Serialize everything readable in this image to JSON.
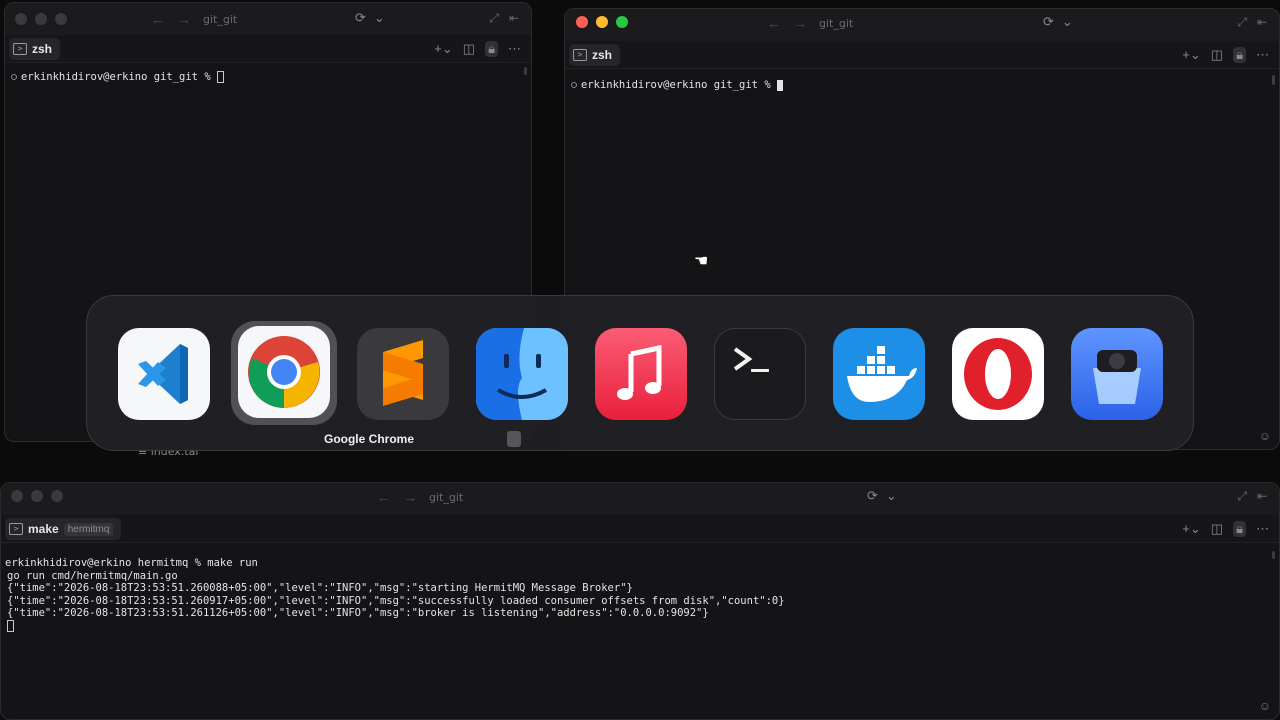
{
  "windows": {
    "top_left": {
      "title": "git_git",
      "tab_label": "zsh",
      "prompt": "erkinkhidirov@erkino git_git % "
    },
    "top_right": {
      "title": "git_git",
      "tab_label": "zsh",
      "prompt": "erkinkhidirov@erkino git_git % "
    },
    "bottom": {
      "title": "git_git",
      "tab_label": "make",
      "tab_sub": "hermitmq",
      "lines": [
        "erkinkhidirov@erkino hermitmq % make run",
        "go run cmd/hermitmq/main.go",
        "{\"time\":\"2026-08-18T23:53:51.260088+05:00\",\"level\":\"INFO\",\"msg\":\"starting HermitMQ Message Broker\"}",
        "{\"time\":\"2026-08-18T23:53:51.260917+05:00\",\"level\":\"INFO\",\"msg\":\"successfully loaded consumer offsets from disk\",\"count\":0}",
        "{\"time\":\"2026-08-18T23:53:51.261126+05:00\",\"level\":\"INFO\",\"msg\":\"broker is listening\",\"address\":\"0.0.0.0:9092\"}"
      ]
    }
  },
  "behind_window_text": "index.tar",
  "app_switcher": {
    "selected_label": "Google Chrome",
    "apps": [
      {
        "name": "Visual Studio Code",
        "icon": "vscode-icon",
        "bg": "#f6f7f9"
      },
      {
        "name": "Google Chrome",
        "icon": "chrome-icon",
        "bg": "#f6f7f9"
      },
      {
        "name": "Sublime Text",
        "icon": "sublime-icon",
        "bg": "#3a3a3c"
      },
      {
        "name": "Finder",
        "icon": "finder-icon",
        "bg": "#2f8ef5"
      },
      {
        "name": "Music",
        "icon": "music-icon",
        "bg": "#f23b56"
      },
      {
        "name": "Terminal",
        "icon": "terminal-icon",
        "bg": "#1b1b1d"
      },
      {
        "name": "Docker",
        "icon": "docker-icon",
        "bg": "#1d8fe6"
      },
      {
        "name": "Opera",
        "icon": "opera-icon",
        "bg": "#ffffff"
      },
      {
        "name": "Lens",
        "icon": "lens-icon",
        "bg": "#3b7df0"
      }
    ]
  }
}
